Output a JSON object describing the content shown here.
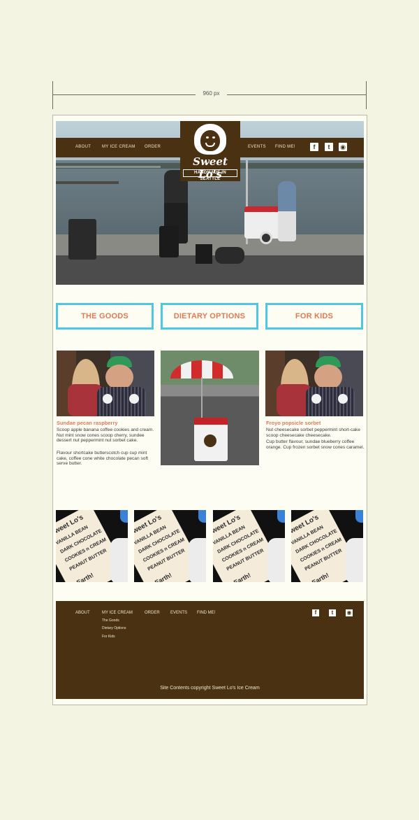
{
  "ruler": {
    "label": "960 px"
  },
  "nav": {
    "items": [
      "ABOUT",
      "MY ICE CREAM",
      "ORDER",
      "EVENTS",
      "FIND ME!"
    ],
    "social": [
      {
        "icon": "facebook-icon",
        "glyph": "f"
      },
      {
        "icon": "twitter-icon",
        "glyph": "t"
      },
      {
        "icon": "instagram-icon",
        "glyph": "◉"
      }
    ]
  },
  "logo": {
    "brand": "Sweet Lo's",
    "tagline": "HANDMADE IN SEATTLE"
  },
  "categories": [
    "THE GOODS",
    "DIETARY OPTIONS",
    "FOR KIDS"
  ],
  "products": [
    {
      "title": "Sundae pecan raspberry",
      "p1": "Scoop apple banana coffee cookies and cream. Nut mint snow cones scoop cherry, sundee dessert nut peppermint nut sorbet cake.",
      "p2": "Flavour shortcake butterscotch cup cup mint cake, coffee cone white chocolate pecan soft serve butter."
    },
    {
      "title": "Froyo popsicle sorbet",
      "p1": "Nut cheesecake sorbet peppermint short-cake scoop cheesecake cheesecake.",
      "p2": "Cup butter flavour, sundae blueberry coffee orange. Cup frozen sorbet snow cones caramel."
    }
  ],
  "gallery": {
    "card_lines": [
      "Sweet Lo's",
      "VANILLA BEAN",
      "DARK CHOCOLATE",
      "COOKIES n CREAM",
      "PEANUT BUTTER",
      "Earth!"
    ]
  },
  "footer": {
    "items": [
      "ABOUT",
      "MY ICE CREAM",
      "ORDER",
      "EVENTS",
      "FIND ME!"
    ],
    "submenu": [
      "The Goods",
      "Dietary Options",
      "For Kids"
    ],
    "copyright": "Site Contents copyright Sweet Lo's Ice Cream"
  },
  "colors": {
    "brand_brown": "#4a3111",
    "accent_cyan": "#4cc8e2",
    "accent_orange": "#e07a55",
    "background": "#f3f5e2"
  }
}
